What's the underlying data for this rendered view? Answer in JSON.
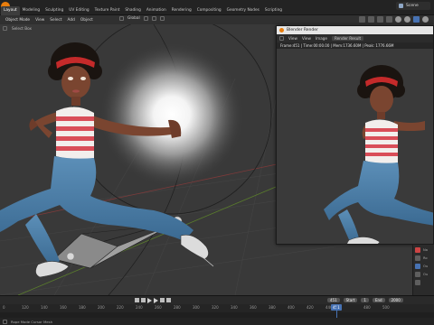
{
  "topbar": {
    "tabs": [
      "Layout",
      "Modeling",
      "Sculpting",
      "UV Editing",
      "Texture Paint",
      "Shading",
      "Animation",
      "Rendering",
      "Compositing",
      "Geometry Nodes",
      "Scripting"
    ],
    "active_tab": "Layout",
    "scene_label": "Scene"
  },
  "viewport_header": {
    "mode": "Object Mode",
    "menus": [
      "View",
      "Select",
      "Add",
      "Object"
    ],
    "orientation": "Global",
    "tool": "Select Box"
  },
  "render_window": {
    "title": "Blender Render",
    "menus": [
      "View",
      "View",
      "Image"
    ],
    "slot": "Render Result",
    "info": "Frame:451 | Time:00:00.00 | Mem:1736.60M | Peak: 1776.66M"
  },
  "right_panel": {
    "labels": [
      "Na",
      "Ro",
      "Ou",
      "Ou"
    ]
  },
  "timeline": {
    "current_frame": "451",
    "start_label": "Start",
    "start_value": "1",
    "end_label": "End",
    "end_value": "2000",
    "frame_field": "451",
    "ticks": [
      "0",
      "120",
      "140",
      "160",
      "180",
      "200",
      "220",
      "240",
      "260",
      "280",
      "300",
      "320",
      "340",
      "360",
      "380",
      "400",
      "420",
      "440",
      "480",
      "500"
    ]
  },
  "statusbar": {
    "text": "Rope Mode Cursor Mesh"
  },
  "colors": {
    "accent": "#4772b3",
    "blender_orange": "#e87d0d",
    "viewport_bg": "#393939"
  }
}
